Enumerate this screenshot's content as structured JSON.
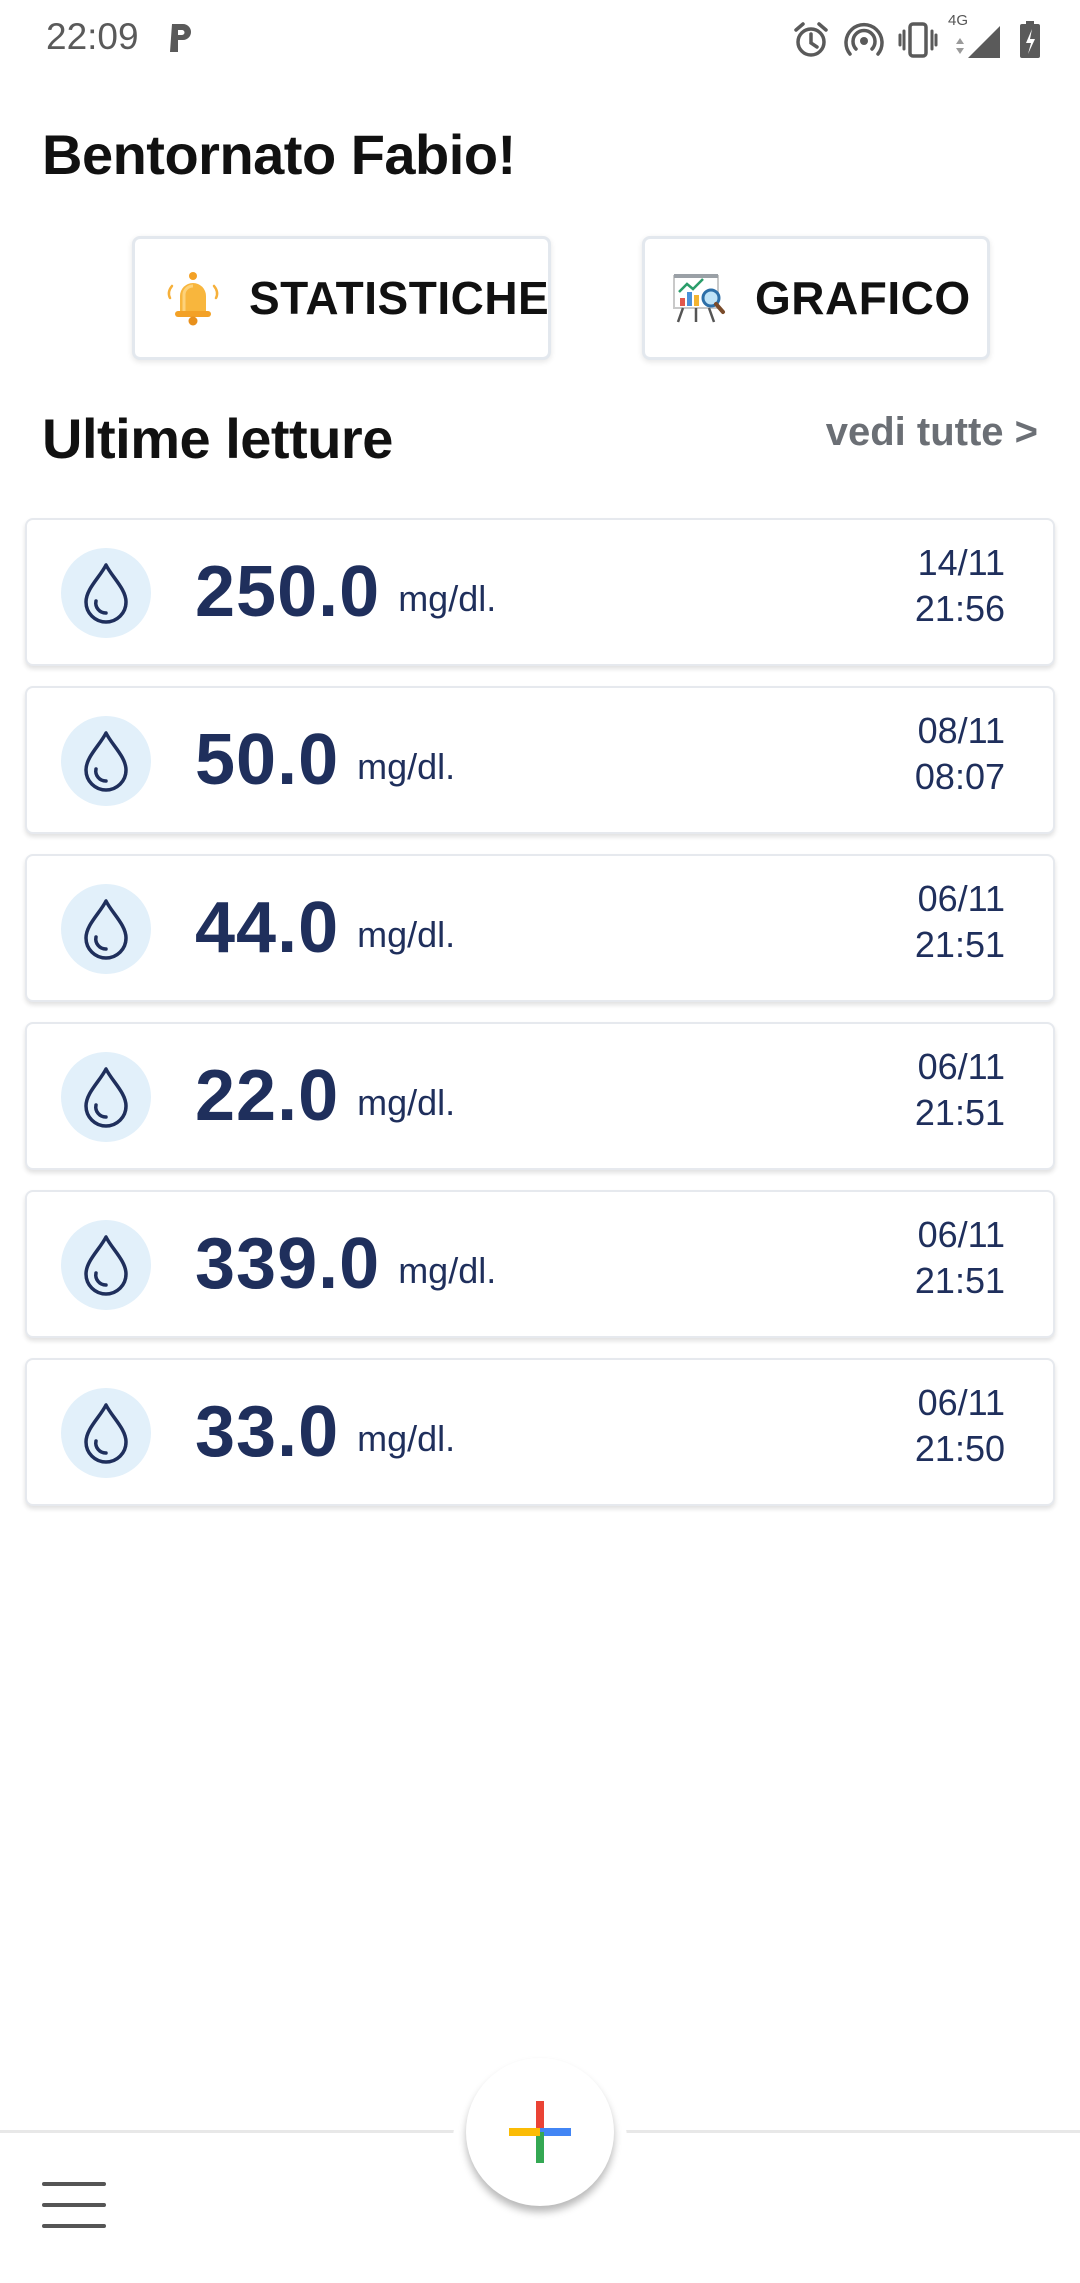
{
  "status_bar": {
    "time": "22:09",
    "network_label": "4G",
    "icons": [
      "parking-icon",
      "alarm-icon",
      "hotspot-icon",
      "vibrate-icon",
      "signal-icon",
      "battery-charging-icon"
    ]
  },
  "header": {
    "greeting": "Bentornato Fabio!"
  },
  "actions": {
    "stats_label": "STATISTICHE",
    "stats_icon": "bell-icon",
    "chart_label": "GRAFICO",
    "chart_icon": "chart-presentation-icon"
  },
  "section": {
    "title": "Ultime letture",
    "see_all": "vedi tutte >"
  },
  "readings": [
    {
      "value": "250.0",
      "unit": "mg/dl.",
      "date": "14/11",
      "time": "21:56"
    },
    {
      "value": "50.0",
      "unit": "mg/dl.",
      "date": "08/11",
      "time": "08:07"
    },
    {
      "value": "44.0",
      "unit": "mg/dl.",
      "date": "06/11",
      "time": "21:51"
    },
    {
      "value": "22.0",
      "unit": "mg/dl.",
      "date": "06/11",
      "time": "21:51"
    },
    {
      "value": "339.0",
      "unit": "mg/dl.",
      "date": "06/11",
      "time": "21:51"
    },
    {
      "value": "33.0",
      "unit": "mg/dl.",
      "date": "06/11",
      "time": "21:50"
    }
  ],
  "colors": {
    "accent_text": "#1f2f5c",
    "drop_bg": "#e2f0fa",
    "plus_red": "#ea4335",
    "plus_blue": "#4285f4",
    "plus_yellow": "#fbbc05",
    "plus_green": "#34a853"
  }
}
